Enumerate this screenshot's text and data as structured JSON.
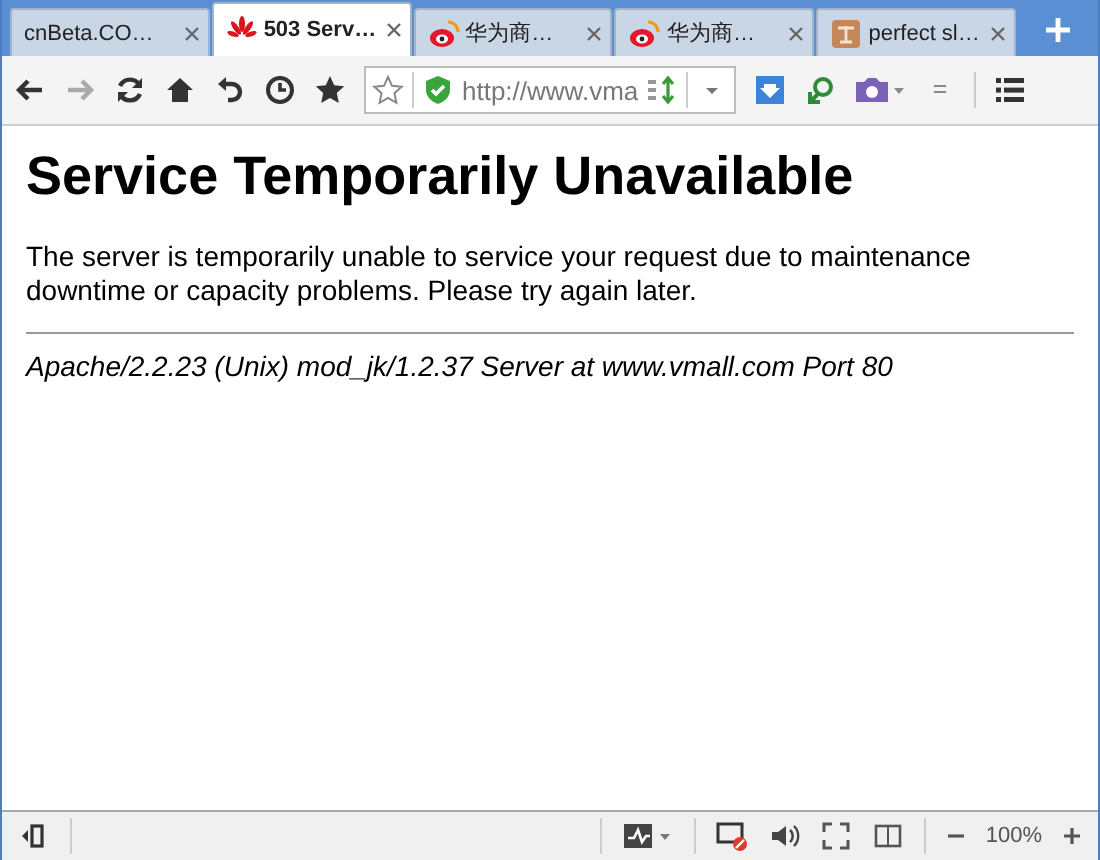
{
  "tabs": [
    {
      "title": "cnBeta.CO…",
      "kind": "plain",
      "selected": false
    },
    {
      "title": "503 Serv…",
      "kind": "flower",
      "selected": true
    },
    {
      "title": "华为商…",
      "kind": "eye",
      "selected": false
    },
    {
      "title": "华为商…",
      "kind": "eye",
      "selected": false
    },
    {
      "title": "perfect sl…",
      "kind": "square",
      "selected": false
    }
  ],
  "address_bar": {
    "url": "http://www.vma"
  },
  "page": {
    "heading": "Service Temporarily Unavailable",
    "message": "The server is temporarily unable to service your request due to maintenance downtime or capacity problems. Please try again later.",
    "footer": "Apache/2.2.23 (Unix) mod_jk/1.2.37 Server at www.vmall.com Port 80"
  },
  "status_bar": {
    "zoom": "100%"
  }
}
